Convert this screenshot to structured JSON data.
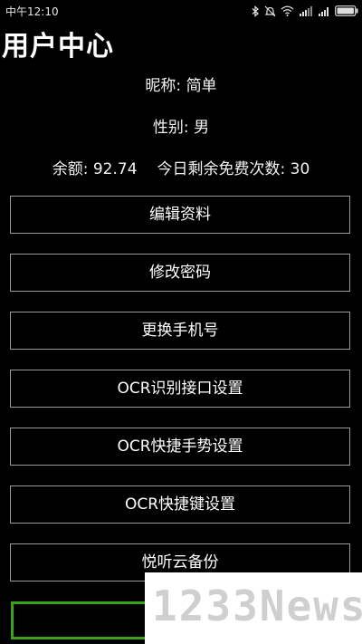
{
  "status_bar": {
    "time": "中午12:10",
    "icons": [
      "bluetooth-icon",
      "mute-icon",
      "wifi-icon",
      "4g-signal-icon",
      "signal-icon",
      "battery-icon"
    ]
  },
  "page": {
    "title": "用户中心"
  },
  "profile": {
    "nickname_label": "昵称",
    "nickname_value": "简单",
    "gender_label": "性别",
    "gender_value": "男",
    "balance_label": "余额",
    "balance_value": "92.74",
    "free_count_label": "今日剩余免费次数",
    "free_count_value": "30"
  },
  "menu": {
    "items": [
      {
        "label": "编辑资料"
      },
      {
        "label": "修改密码"
      },
      {
        "label": "更换手机号"
      },
      {
        "label": "OCR识别接口设置"
      },
      {
        "label": "OCR快捷手势设置"
      },
      {
        "label": "OCR快捷键设置"
      },
      {
        "label": "悦听云备份"
      }
    ]
  },
  "watermark": {
    "text": "1233News"
  },
  "colors": {
    "background": "#000000",
    "text": "#ffffff",
    "button_border": "#9a9a9a",
    "accent_green": "#3aa31b"
  }
}
